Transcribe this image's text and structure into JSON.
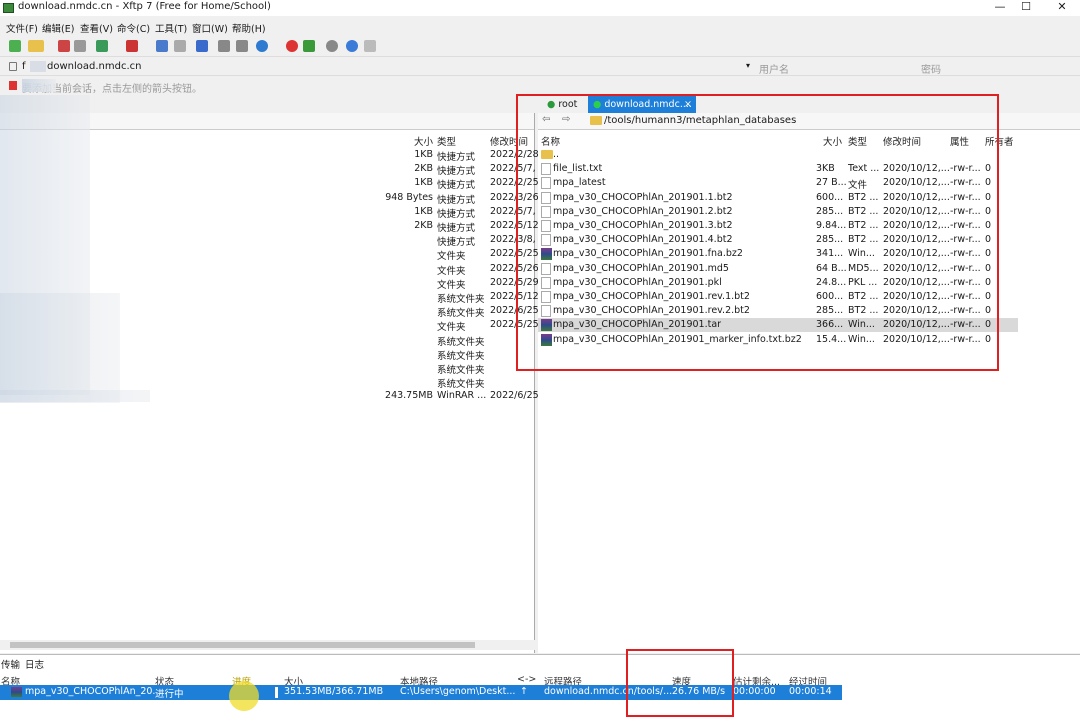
{
  "window": {
    "title": "download.nmdc.cn - Xftp 7 (Free for Home/School)",
    "min": "—",
    "max": "☐",
    "close": "✕"
  },
  "menu": [
    "文件(F)",
    "编辑(E)",
    "查看(V)",
    "命令(C)",
    "工具(T)",
    "窗口(W)",
    "帮助(H)"
  ],
  "address": {
    "host": "download.nmdc.cn",
    "host_prefix": "f",
    "user_placeholder": "用户名",
    "password_placeholder": "密码"
  },
  "hint": "要添加当前会话，点击左侧的箭头按钮。",
  "left_pane": {
    "columns": {
      "size": "大小",
      "type": "类型",
      "modified": "修改时间"
    },
    "rows": [
      {
        "size": "1KB",
        "type": "快捷方式",
        "modified": "2022/2/28"
      },
      {
        "size": "2KB",
        "type": "快捷方式",
        "modified": "2022/5/7,"
      },
      {
        "size": "1KB",
        "type": "快捷方式",
        "modified": "2022/2/25"
      },
      {
        "size": "948 Bytes",
        "type": "快捷方式",
        "modified": "2022/3/26"
      },
      {
        "size": "1KB",
        "type": "快捷方式",
        "modified": "2022/5/7,"
      },
      {
        "size": "2KB",
        "type": "快捷方式",
        "modified": "2022/5/12"
      },
      {
        "size": "",
        "type": "快捷方式",
        "modified": "2022/3/8,"
      },
      {
        "size": "",
        "type": "文件夹",
        "modified": "2022/5/25"
      },
      {
        "size": "",
        "type": "文件夹",
        "modified": "2022/5/26"
      },
      {
        "size": "",
        "type": "文件夹",
        "modified": "2022/5/29"
      },
      {
        "size": "",
        "type": "系统文件夹",
        "modified": "2022/5/12"
      },
      {
        "size": "",
        "type": "系统文件夹",
        "modified": "2022/6/25"
      },
      {
        "size": "",
        "type": "文件夹",
        "modified": "2022/5/25"
      },
      {
        "size": "",
        "type": "系统文件夹",
        "modified": ""
      },
      {
        "size": "",
        "type": "系统文件夹",
        "modified": ""
      },
      {
        "size": "",
        "type": "系统文件夹",
        "modified": ""
      },
      {
        "size": "",
        "type": "系统文件夹",
        "modified": ""
      },
      {
        "size": "243.75MB",
        "type": "WinRAR ...",
        "modified": "2022/6/25"
      }
    ]
  },
  "tabs": [
    {
      "label": "root"
    },
    {
      "label": "download.nmdc....",
      "close": "×"
    }
  ],
  "right_pane": {
    "path": "/tools/humann3/metaphlan_databases",
    "columns": {
      "name": "名称",
      "size": "大小",
      "type": "类型",
      "modified": "修改时间",
      "attr": "属性",
      "owner": "所有者"
    },
    "rows": [
      {
        "name": "..",
        "size": "",
        "type": "",
        "modified": "",
        "attr": "",
        "owner": "",
        "icon": "folder"
      },
      {
        "name": "file_list.txt",
        "size": "3KB",
        "type": "Text ...",
        "modified": "2020/10/12,...",
        "attr": "-rw-r...",
        "owner": "0",
        "icon": "file"
      },
      {
        "name": "mpa_latest",
        "size": "27 B...",
        "type": "文件",
        "modified": "2020/10/12,...",
        "attr": "-rw-r...",
        "owner": "0",
        "icon": "file"
      },
      {
        "name": "mpa_v30_CHOCOPhlAn_201901.1.bt2",
        "size": "600...",
        "type": "BT2 ...",
        "modified": "2020/10/12,...",
        "attr": "-rw-r...",
        "owner": "0",
        "icon": "file"
      },
      {
        "name": "mpa_v30_CHOCOPhlAn_201901.2.bt2",
        "size": "285...",
        "type": "BT2 ...",
        "modified": "2020/10/12,...",
        "attr": "-rw-r...",
        "owner": "0",
        "icon": "file"
      },
      {
        "name": "mpa_v30_CHOCOPhlAn_201901.3.bt2",
        "size": "9.84...",
        "type": "BT2 ...",
        "modified": "2020/10/12,...",
        "attr": "-rw-r...",
        "owner": "0",
        "icon": "file"
      },
      {
        "name": "mpa_v30_CHOCOPhlAn_201901.4.bt2",
        "size": "285...",
        "type": "BT2 ...",
        "modified": "2020/10/12,...",
        "attr": "-rw-r...",
        "owner": "0",
        "icon": "file"
      },
      {
        "name": "mpa_v30_CHOCOPhlAn_201901.fna.bz2",
        "size": "341...",
        "type": "Win...",
        "modified": "2020/10/12,...",
        "attr": "-rw-r...",
        "owner": "0",
        "icon": "rar"
      },
      {
        "name": "mpa_v30_CHOCOPhlAn_201901.md5",
        "size": "64 B...",
        "type": "MD5...",
        "modified": "2020/10/12,...",
        "attr": "-rw-r...",
        "owner": "0",
        "icon": "file"
      },
      {
        "name": "mpa_v30_CHOCOPhlAn_201901.pkl",
        "size": "24.8...",
        "type": "PKL ...",
        "modified": "2020/10/12,...",
        "attr": "-rw-r...",
        "owner": "0",
        "icon": "file"
      },
      {
        "name": "mpa_v30_CHOCOPhlAn_201901.rev.1.bt2",
        "size": "600...",
        "type": "BT2 ...",
        "modified": "2020/10/12,...",
        "attr": "-rw-r...",
        "owner": "0",
        "icon": "file"
      },
      {
        "name": "mpa_v30_CHOCOPhlAn_201901.rev.2.bt2",
        "size": "285...",
        "type": "BT2 ...",
        "modified": "2020/10/12,...",
        "attr": "-rw-r...",
        "owner": "0",
        "icon": "file"
      },
      {
        "name": "mpa_v30_CHOCOPhlAn_201901.tar",
        "size": "366...",
        "type": "Win...",
        "modified": "2020/10/12,...",
        "attr": "-rw-r...",
        "owner": "0",
        "icon": "rar",
        "selected": true
      },
      {
        "name": "mpa_v30_CHOCOPhlAn_201901_marker_info.txt.bz2",
        "size": "15.4...",
        "type": "Win...",
        "modified": "2020/10/12,...",
        "attr": "-rw-r...",
        "owner": "0",
        "icon": "rar"
      }
    ]
  },
  "bottom": {
    "tabs": [
      "传输",
      "日志"
    ],
    "columns": {
      "name": "名称",
      "status": "状态",
      "progress": "进度",
      "size": "大小",
      "local": "本地路径",
      "dir": "<->",
      "remote": "远程路径",
      "speed": "速度",
      "eta": "估计剩余...",
      "elapsed": "经过时间"
    },
    "transfer": {
      "name": "mpa_v30_CHOCOPhlAn_20...",
      "status": "进行中",
      "progress": 0.96,
      "size": "351.53MB/366.71MB",
      "local": "C:\\Users\\genom\\Deskt...",
      "dir": "↑",
      "remote": "download.nmdc.cn/tools/...",
      "speed": "26.76 MB/s",
      "eta": "00:00:00",
      "elapsed": "00:00:14"
    }
  },
  "colors": {
    "accent": "#1e7fd8",
    "highlight": "#e02020",
    "selected_row": "#d9d9d9"
  }
}
